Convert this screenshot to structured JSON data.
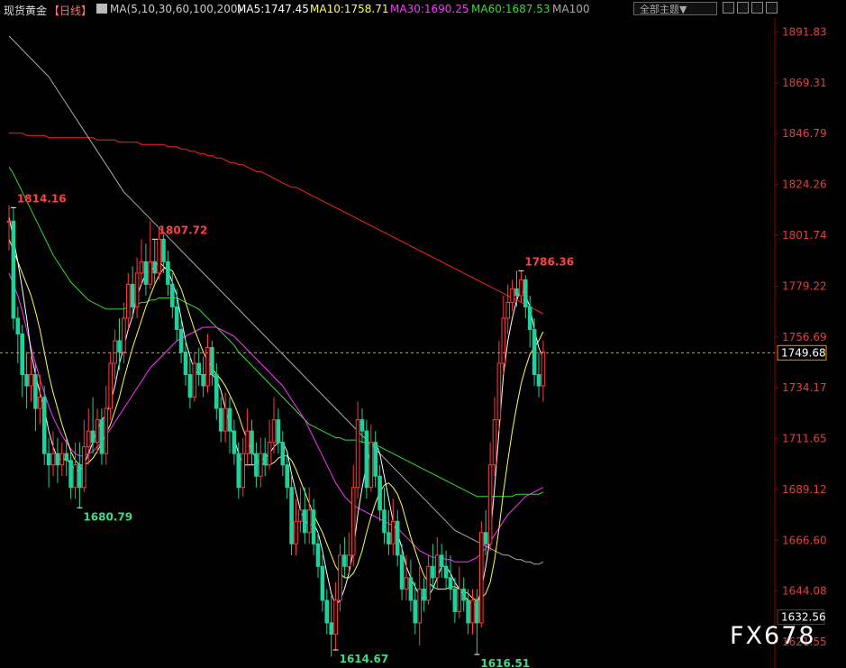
{
  "header": {
    "symbol": "现货黄金",
    "period": "【日线】",
    "ma_params": "MA(5,10,30,60,100,200)",
    "ma5": "MA5:1747.45",
    "ma10": "MA10:1758.71",
    "ma30": "MA30:1690.25",
    "ma60": "MA60:1687.53",
    "ma100": "MA100",
    "theme_select": "全部主题▼"
  },
  "colors": {
    "up": "#ff3b3b",
    "down": "#1fd19b",
    "ma5": "#ffffff",
    "ma10": "#ffff55",
    "ma30": "#ff33ff",
    "ma60": "#33dd33",
    "ma100": "#aaaaaa",
    "ma200": "#ff2222",
    "price_label": "#e0403a",
    "current": "#ff8c00"
  },
  "watermark": "FX678",
  "chart_data": {
    "type": "candlestick",
    "ylim": [
      1610,
      1898
    ],
    "y_ticks": [
      "1891.83",
      "1869.31",
      "1846.79",
      "1824.26",
      "1801.74",
      "1779.22",
      "1756.69",
      "1734.17",
      "1711.65",
      "1689.12",
      "1666.60",
      "1644.08",
      "1621.55"
    ],
    "current_price": "1749.68",
    "low_label_price": "1632.56",
    "annotations": [
      {
        "text": "1814.16",
        "type": "high",
        "index": 1
      },
      {
        "text": "1807.72",
        "type": "high",
        "index": 33
      },
      {
        "text": "1680.79",
        "type": "low",
        "index": 16
      },
      {
        "text": "1614.67",
        "type": "low",
        "index": 74
      },
      {
        "text": "1616.51",
        "type": "low",
        "index": 106
      },
      {
        "text": "1786.36",
        "type": "high",
        "index": 116
      }
    ],
    "candles": [
      [
        1808,
        1808,
        1815,
        1795
      ],
      [
        1808,
        1765,
        1814,
        1760
      ],
      [
        1765,
        1758,
        1770,
        1745
      ],
      [
        1758,
        1740,
        1762,
        1730
      ],
      [
        1740,
        1735,
        1750,
        1725
      ],
      [
        1735,
        1740,
        1748,
        1728
      ],
      [
        1740,
        1725,
        1745,
        1715
      ],
      [
        1725,
        1730,
        1740,
        1718
      ],
      [
        1730,
        1705,
        1735,
        1700
      ],
      [
        1705,
        1700,
        1712,
        1690
      ],
      [
        1700,
        1705,
        1715,
        1695
      ],
      [
        1705,
        1700,
        1712,
        1692
      ],
      [
        1700,
        1705,
        1710,
        1695
      ],
      [
        1705,
        1702,
        1712,
        1695
      ],
      [
        1702,
        1690,
        1706,
        1685
      ],
      [
        1690,
        1700,
        1710,
        1685
      ],
      [
        1700,
        1690,
        1710,
        1681
      ],
      [
        1690,
        1708,
        1720,
        1688
      ],
      [
        1708,
        1715,
        1725,
        1700
      ],
      [
        1715,
        1710,
        1730,
        1705
      ],
      [
        1710,
        1720,
        1725,
        1705
      ],
      [
        1720,
        1705,
        1725,
        1700
      ],
      [
        1705,
        1725,
        1735,
        1700
      ],
      [
        1725,
        1745,
        1750,
        1720
      ],
      [
        1745,
        1755,
        1760,
        1738
      ],
      [
        1755,
        1750,
        1765,
        1742
      ],
      [
        1750,
        1765,
        1772,
        1745
      ],
      [
        1765,
        1780,
        1785,
        1760
      ],
      [
        1780,
        1770,
        1788,
        1765
      ],
      [
        1770,
        1785,
        1792,
        1765
      ],
      [
        1785,
        1790,
        1800,
        1780
      ],
      [
        1790,
        1780,
        1798,
        1775
      ],
      [
        1780,
        1790,
        1808,
        1778
      ],
      [
        1790,
        1785,
        1800,
        1780
      ],
      [
        1785,
        1800,
        1805,
        1782
      ],
      [
        1800,
        1790,
        1802,
        1785
      ],
      [
        1790,
        1780,
        1795,
        1775
      ],
      [
        1780,
        1770,
        1785,
        1765
      ],
      [
        1770,
        1760,
        1778,
        1755
      ],
      [
        1760,
        1750,
        1765,
        1745
      ],
      [
        1750,
        1740,
        1755,
        1735
      ],
      [
        1740,
        1730,
        1748,
        1725
      ],
      [
        1730,
        1745,
        1750,
        1728
      ],
      [
        1745,
        1740,
        1752,
        1735
      ],
      [
        1740,
        1735,
        1748,
        1730
      ],
      [
        1735,
        1752,
        1758,
        1732
      ],
      [
        1752,
        1740,
        1755,
        1735
      ],
      [
        1740,
        1725,
        1745,
        1720
      ],
      [
        1725,
        1715,
        1730,
        1710
      ],
      [
        1715,
        1725,
        1732,
        1710
      ],
      [
        1725,
        1715,
        1730,
        1705
      ],
      [
        1715,
        1705,
        1720,
        1700
      ],
      [
        1705,
        1690,
        1710,
        1685
      ],
      [
        1690,
        1705,
        1712,
        1686
      ],
      [
        1705,
        1715,
        1725,
        1700
      ],
      [
        1715,
        1705,
        1720,
        1700
      ],
      [
        1705,
        1695,
        1710,
        1690
      ],
      [
        1695,
        1705,
        1712,
        1690
      ],
      [
        1705,
        1700,
        1712,
        1695
      ],
      [
        1700,
        1710,
        1720,
        1698
      ],
      [
        1710,
        1720,
        1730,
        1705
      ],
      [
        1720,
        1710,
        1725,
        1705
      ],
      [
        1710,
        1700,
        1715,
        1695
      ],
      [
        1700,
        1690,
        1705,
        1685
      ],
      [
        1690,
        1665,
        1695,
        1660
      ],
      [
        1665,
        1675,
        1685,
        1660
      ],
      [
        1675,
        1680,
        1690,
        1670
      ],
      [
        1680,
        1670,
        1690,
        1665
      ],
      [
        1670,
        1680,
        1690,
        1665
      ],
      [
        1680,
        1665,
        1685,
        1660
      ],
      [
        1665,
        1655,
        1670,
        1650
      ],
      [
        1655,
        1640,
        1660,
        1635
      ],
      [
        1640,
        1630,
        1645,
        1625
      ],
      [
        1630,
        1625,
        1642,
        1615
      ],
      [
        1625,
        1640,
        1648,
        1618
      ],
      [
        1640,
        1660,
        1665,
        1635
      ],
      [
        1660,
        1655,
        1668,
        1650
      ],
      [
        1655,
        1660,
        1670,
        1652
      ],
      [
        1660,
        1690,
        1700,
        1655
      ],
      [
        1690,
        1720,
        1728,
        1685
      ],
      [
        1720,
        1715,
        1725,
        1710
      ],
      [
        1715,
        1690,
        1720,
        1685
      ],
      [
        1690,
        1710,
        1718,
        1688
      ],
      [
        1710,
        1695,
        1715,
        1690
      ],
      [
        1695,
        1680,
        1700,
        1675
      ],
      [
        1680,
        1670,
        1690,
        1665
      ],
      [
        1670,
        1665,
        1680,
        1660
      ],
      [
        1665,
        1675,
        1685,
        1660
      ],
      [
        1675,
        1660,
        1680,
        1655
      ],
      [
        1660,
        1645,
        1665,
        1640
      ],
      [
        1645,
        1650,
        1660,
        1640
      ],
      [
        1650,
        1640,
        1658,
        1635
      ],
      [
        1640,
        1630,
        1648,
        1625
      ],
      [
        1630,
        1645,
        1655,
        1620
      ],
      [
        1645,
        1640,
        1650,
        1635
      ],
      [
        1640,
        1655,
        1660,
        1638
      ],
      [
        1655,
        1650,
        1665,
        1645
      ],
      [
        1650,
        1660,
        1668,
        1645
      ],
      [
        1660,
        1655,
        1665,
        1650
      ],
      [
        1655,
        1650,
        1662,
        1645
      ],
      [
        1650,
        1645,
        1660,
        1640
      ],
      [
        1645,
        1635,
        1650,
        1630
      ],
      [
        1635,
        1645,
        1655,
        1632
      ],
      [
        1645,
        1640,
        1650,
        1635
      ],
      [
        1640,
        1630,
        1645,
        1625
      ],
      [
        1630,
        1640,
        1645,
        1625
      ],
      [
        1640,
        1630,
        1645,
        1616
      ],
      [
        1630,
        1670,
        1675,
        1628
      ],
      [
        1670,
        1665,
        1680,
        1660
      ],
      [
        1665,
        1700,
        1710,
        1662
      ],
      [
        1700,
        1720,
        1730,
        1695
      ],
      [
        1720,
        1745,
        1755,
        1715
      ],
      [
        1745,
        1765,
        1775,
        1740
      ],
      [
        1765,
        1772,
        1780,
        1758
      ],
      [
        1772,
        1778,
        1782,
        1768
      ],
      [
        1778,
        1775,
        1786,
        1770
      ],
      [
        1775,
        1782,
        1786,
        1772
      ],
      [
        1782,
        1770,
        1784,
        1765
      ],
      [
        1770,
        1760,
        1775,
        1752
      ],
      [
        1760,
        1740,
        1765,
        1735
      ],
      [
        1740,
        1735,
        1750,
        1730
      ],
      [
        1735,
        1750,
        1755,
        1728
      ]
    ],
    "ma5": [
      1810,
      1800,
      1790,
      1778,
      1765,
      1750,
      1740,
      1732,
      1725,
      1715,
      1708,
      1703,
      1702,
      1703,
      1700,
      1698,
      1697,
      1700,
      1705,
      1710,
      1715,
      1720,
      1722,
      1728,
      1735,
      1745,
      1752,
      1760,
      1766,
      1775,
      1780,
      1785,
      1786,
      1788,
      1790,
      1788,
      1786,
      1781,
      1775,
      1765,
      1755,
      1748,
      1742,
      1740,
      1740,
      1740,
      1740,
      1738,
      1733,
      1725,
      1718,
      1712,
      1705,
      1700,
      1700,
      1700,
      1700,
      1702,
      1703,
      1705,
      1708,
      1710,
      1710,
      1706,
      1696,
      1688,
      1680,
      1676,
      1673,
      1674,
      1670,
      1662,
      1652,
      1643,
      1638,
      1640,
      1645,
      1652,
      1662,
      1678,
      1690,
      1700,
      1708,
      1710,
      1705,
      1695,
      1685,
      1675,
      1670,
      1663,
      1655,
      1650,
      1646,
      1642,
      1640,
      1642,
      1645,
      1650,
      1655,
      1655,
      1652,
      1648,
      1645,
      1642,
      1640,
      1638,
      1638,
      1645,
      1655,
      1668,
      1690,
      1715,
      1740,
      1755,
      1765,
      1773,
      1778,
      1775,
      1770,
      1760,
      1752,
      1747
    ],
    "ma10": [
      1800,
      1795,
      1790,
      1785,
      1780,
      1775,
      1768,
      1760,
      1750,
      1740,
      1732,
      1725,
      1718,
      1712,
      1706,
      1702,
      1700,
      1700,
      1701,
      1703,
      1706,
      1710,
      1714,
      1718,
      1724,
      1730,
      1738,
      1745,
      1752,
      1758,
      1764,
      1770,
      1775,
      1780,
      1784,
      1787,
      1787,
      1786,
      1782,
      1778,
      1772,
      1766,
      1760,
      1755,
      1750,
      1746,
      1743,
      1740,
      1738,
      1735,
      1731,
      1727,
      1722,
      1716,
      1711,
      1706,
      1703,
      1701,
      1700,
      1700,
      1701,
      1703,
      1704,
      1704,
      1702,
      1698,
      1693,
      1688,
      1683,
      1678,
      1674,
      1670,
      1665,
      1660,
      1655,
      1652,
      1650,
      1650,
      1652,
      1656,
      1662,
      1670,
      1677,
      1683,
      1688,
      1691,
      1692,
      1690,
      1687,
      1682,
      1675,
      1668,
      1662,
      1656,
      1651,
      1648,
      1646,
      1645,
      1645,
      1645,
      1646,
      1646,
      1645,
      1644,
      1643,
      1641,
      1640,
      1641,
      1643,
      1648,
      1658,
      1672,
      1688,
      1702,
      1715,
      1726,
      1736,
      1743,
      1749,
      1752,
      1755,
      1759
    ],
    "ma30": [
      1785,
      1780,
      1775,
      1768,
      1760,
      1752,
      1745,
      1738,
      1732,
      1726,
      1721,
      1717,
      1713,
      1710,
      1707,
      1705,
      1704,
      1704,
      1705,
      1706,
      1708,
      1710,
      1713,
      1716,
      1719,
      1722,
      1725,
      1728,
      1731,
      1734,
      1737,
      1740,
      1743,
      1745,
      1747,
      1749,
      1751,
      1753,
      1755,
      1756,
      1757,
      1758,
      1759,
      1760,
      1761,
      1761,
      1761,
      1761,
      1760,
      1759,
      1758,
      1757,
      1755,
      1753,
      1751,
      1749,
      1747,
      1745,
      1743,
      1741,
      1739,
      1737,
      1735,
      1732,
      1729,
      1726,
      1723,
      1720,
      1716,
      1712,
      1708,
      1704,
      1700,
      1696,
      1692,
      1689,
      1686,
      1684,
      1682,
      1681,
      1680,
      1679,
      1678,
      1677,
      1676,
      1675,
      1674,
      1673,
      1672,
      1670,
      1668,
      1666,
      1664,
      1662,
      1661,
      1660,
      1659,
      1659,
      1659,
      1658,
      1658,
      1657,
      1657,
      1657,
      1657,
      1658,
      1659,
      1661,
      1663,
      1666,
      1669,
      1672,
      1675,
      1678,
      1680,
      1682,
      1684,
      1686,
      1687,
      1688,
      1689,
      1690
    ],
    "ma60": [
      1832,
      1829,
      1825,
      1821,
      1817,
      1813,
      1809,
      1805,
      1801,
      1797,
      1793,
      1790,
      1787,
      1784,
      1781,
      1779,
      1777,
      1775,
      1773,
      1772,
      1771,
      1770,
      1769,
      1769,
      1769,
      1769,
      1769,
      1770,
      1770,
      1771,
      1772,
      1772,
      1773,
      1773,
      1774,
      1774,
      1774,
      1774,
      1774,
      1773,
      1772,
      1771,
      1770,
      1769,
      1767,
      1765,
      1763,
      1761,
      1759,
      1757,
      1755,
      1753,
      1750,
      1748,
      1746,
      1744,
      1742,
      1740,
      1738,
      1736,
      1734,
      1732,
      1730,
      1728,
      1726,
      1724,
      1722,
      1720,
      1718,
      1717,
      1716,
      1715,
      1714,
      1713,
      1712,
      1712,
      1711,
      1711,
      1711,
      1711,
      1710,
      1710,
      1709,
      1709,
      1708,
      1707,
      1706,
      1705,
      1704,
      1703,
      1702,
      1701,
      1700,
      1699,
      1698,
      1697,
      1696,
      1695,
      1694,
      1693,
      1692,
      1691,
      1690,
      1689,
      1688,
      1687,
      1686,
      1686,
      1686,
      1686,
      1686,
      1686,
      1686,
      1686,
      1686,
      1687,
      1687,
      1687,
      1687,
      1687,
      1687,
      1688
    ],
    "ma100": [
      1890,
      1888,
      1886,
      1884,
      1882,
      1880,
      1878,
      1876,
      1874,
      1872,
      1869,
      1866,
      1863,
      1860,
      1857,
      1854,
      1851,
      1848,
      1845,
      1842,
      1839,
      1836,
      1833,
      1830,
      1827,
      1824,
      1821,
      1819,
      1817,
      1815,
      1813,
      1811,
      1809,
      1807,
      1805,
      1803,
      1801,
      1799,
      1797,
      1795,
      1793,
      1791,
      1789,
      1787,
      1785,
      1783,
      1781,
      1779,
      1777,
      1775,
      1773,
      1771,
      1769,
      1767,
      1765,
      1763,
      1761,
      1759,
      1757,
      1755,
      1753,
      1751,
      1749,
      1747,
      1745,
      1743,
      1741,
      1739,
      1737,
      1735,
      1733,
      1731,
      1729,
      1727,
      1725,
      1723,
      1721,
      1719,
      1717,
      1715,
      1713,
      1711,
      1709,
      1707,
      1705,
      1703,
      1701,
      1699,
      1697,
      1695,
      1693,
      1691,
      1689,
      1687,
      1685,
      1683,
      1681,
      1679,
      1677,
      1675,
      1673,
      1671,
      1670,
      1669,
      1668,
      1667,
      1666,
      1665,
      1664,
      1663,
      1662,
      1661,
      1660,
      1660,
      1659,
      1658,
      1658,
      1657,
      1657,
      1656,
      1656,
      1657
    ],
    "ma200": [
      1847,
      1847,
      1847,
      1847,
      1846,
      1846,
      1846,
      1846,
      1846,
      1845,
      1845,
      1845,
      1845,
      1845,
      1845,
      1845,
      1845,
      1845,
      1845,
      1845,
      1844,
      1844,
      1844,
      1844,
      1844,
      1843,
      1843,
      1843,
      1843,
      1843,
      1842,
      1842,
      1842,
      1842,
      1842,
      1842,
      1841,
      1841,
      1841,
      1840,
      1840,
      1839,
      1839,
      1838,
      1838,
      1837,
      1837,
      1836,
      1836,
      1835,
      1834,
      1834,
      1833,
      1833,
      1832,
      1831,
      1830,
      1830,
      1829,
      1828,
      1827,
      1826,
      1825,
      1824,
      1823,
      1823,
      1822,
      1821,
      1820,
      1819,
      1818,
      1817,
      1816,
      1815,
      1814,
      1813,
      1812,
      1811,
      1810,
      1809,
      1808,
      1807,
      1806,
      1805,
      1804,
      1803,
      1802,
      1801,
      1800,
      1799,
      1798,
      1797,
      1796,
      1795,
      1794,
      1793,
      1792,
      1791,
      1790,
      1789,
      1788,
      1787,
      1786,
      1785,
      1784,
      1783,
      1782,
      1781,
      1780,
      1779,
      1778,
      1777,
      1776,
      1775,
      1774,
      1773,
      1772,
      1771,
      1770,
      1769,
      1768,
      1767
    ]
  }
}
